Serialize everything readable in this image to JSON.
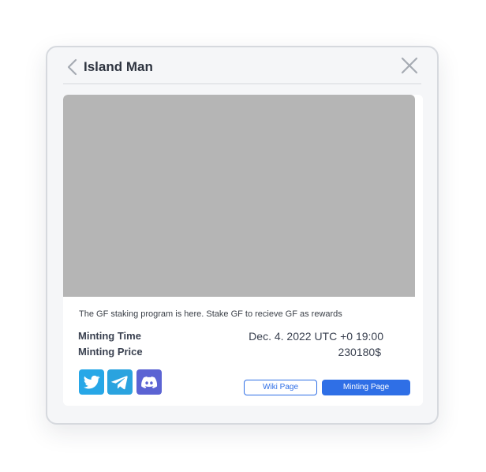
{
  "header": {
    "title": "Island Man"
  },
  "card": {
    "description": "The GF staking program is here. Stake GF to recieve GF as rewards",
    "minting_time_label": "Minting Time",
    "minting_time_value": "Dec. 4. 2022 UTC +0 19:00",
    "minting_price_label": "Minting Price",
    "minting_price_value": "230180$"
  },
  "buttons": {
    "wiki": "Wiki Page",
    "minting": "Minting Page"
  },
  "icons": {
    "back": "chevron-left-icon",
    "close": "close-icon",
    "twitter": "twitter-icon",
    "telegram": "telegram-icon",
    "discord": "discord-icon"
  },
  "colors": {
    "accent": "#2f6fe6",
    "twitter": "#27a7e7",
    "telegram": "#2aa3df",
    "discord": "#5b63d3"
  }
}
